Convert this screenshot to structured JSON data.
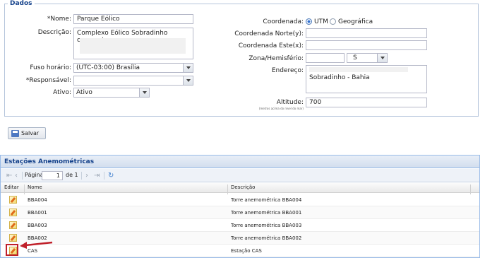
{
  "form": {
    "legend": "Dados",
    "nome_label": "*Nome:",
    "nome_value": "Parque Eólico",
    "descricao_label": "Descrição:",
    "descricao_value": "Complexo Eólico Sobradinho composto",
    "fuso_label": "Fuso horário:",
    "fuso_value": "(UTC-03:00) Brasília",
    "responsavel_label": "*Responsável:",
    "responsavel_value": "",
    "ativo_label": "Ativo:",
    "ativo_value": "Ativo",
    "coordenada_label": "Coordenada:",
    "coord_utm": "UTM",
    "coord_geo": "Geográfica",
    "coord_selected": "UTM",
    "norte_label": "Coordenada Norte(y):",
    "norte_value": "",
    "este_label": "Coordenada Este(x):",
    "este_value": "",
    "zona_label": "Zona/Hemisfério:",
    "zona_value": "",
    "hemisferio_value": "S",
    "endereco_label": "Endereço:",
    "endereco_value": "Sobradinho - Bahia",
    "altitude_label": "Altitude:",
    "altitude_sub": "(metros acima do nível do mar)",
    "altitude_value": "700"
  },
  "save_button": {
    "label": "Salvar",
    "icon": "floppy-disk-icon"
  },
  "grid": {
    "title": "Estações Anemométricas",
    "pager": {
      "page_label": "Página",
      "page_value": "1",
      "of_label": "de 1"
    },
    "columns": {
      "edit": "Editar",
      "name": "Nome",
      "desc": "Descrição"
    },
    "rows": [
      {
        "nome": "BBA004",
        "descricao": "Torre anemométrica BBA004"
      },
      {
        "nome": "BBA001",
        "descricao": "Torre anemométrica BBA001"
      },
      {
        "nome": "BBA003",
        "descricao": "Torre anemométrica BBA003"
      },
      {
        "nome": "BBA002",
        "descricao": "Torre anemométrica BBA002"
      },
      {
        "nome": "CAS",
        "descricao": "Estação CAS"
      }
    ]
  },
  "colors": {
    "accent": "#15428b",
    "highlight": "#c0202a"
  }
}
